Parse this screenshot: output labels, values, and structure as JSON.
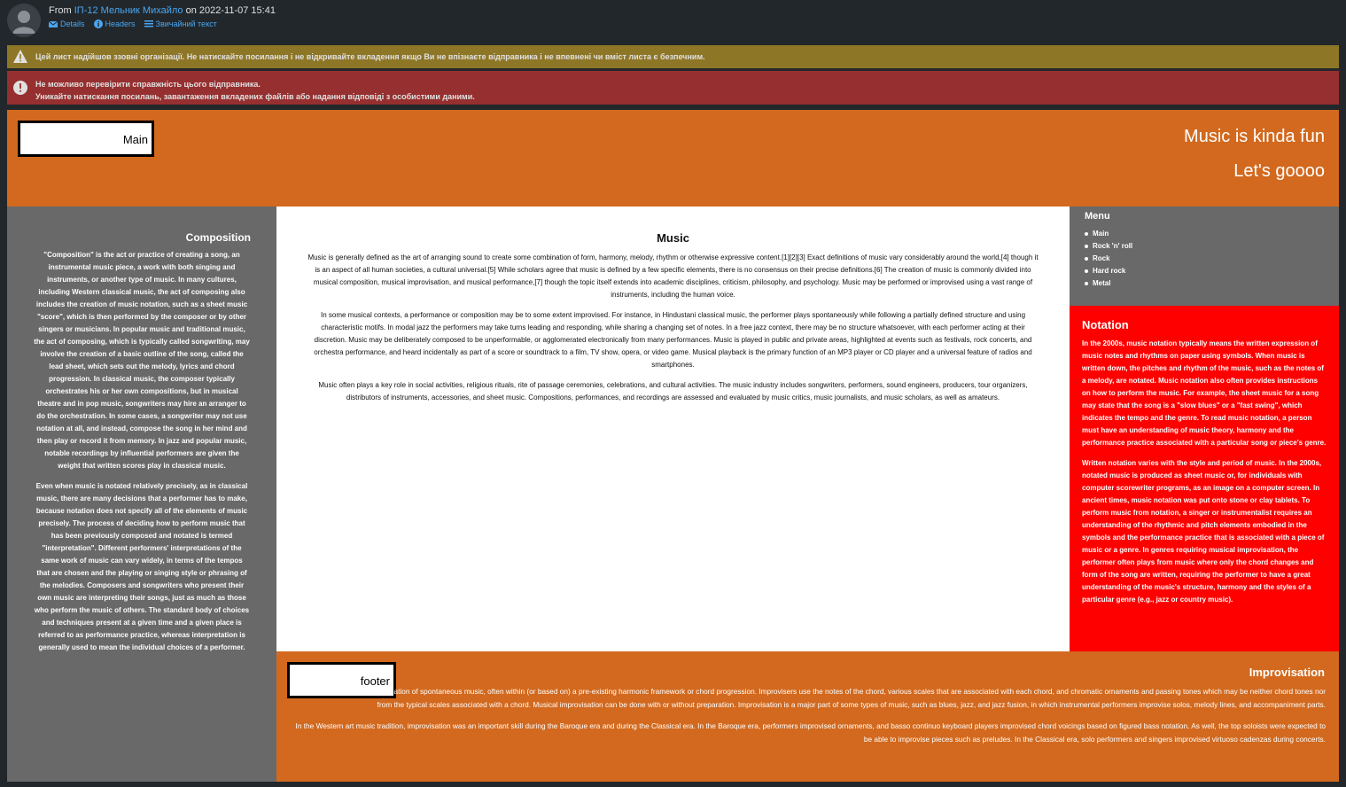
{
  "mail": {
    "from_prefix": "From",
    "sender": "ІП-12 Мельник Михайло",
    "date_prefix": "on",
    "date": "2022-11-07 15:41",
    "actions": [
      "Details",
      "Headers",
      "Звичайний текст"
    ]
  },
  "banners": {
    "warning": "Цей лист надійшов ззовні організації. Не натискайте посилання і не відкривайте вкладення якщо Ви не впізнаєте відправника і не впевнені чи вміст листа є безпечним.",
    "error_line1": "Не можливо перевірити справжність цього відправника.",
    "error_line2": "Уникайте натискання посилань, завантаження вкладених файлів або надання відповіді з особистими даними."
  },
  "header": {
    "main_button": "Main",
    "title": "Music is kinda fun",
    "subtitle": "Let's goooo"
  },
  "composition": {
    "title": "Composition",
    "p1": "\"Composition\" is the act or practice of creating a song, an instrumental music piece, a work with both singing and instruments, or another type of music. In many cultures, including Western classical music, the act of composing also includes the creation of music notation, such as a sheet music \"score\", which is then performed by the composer or by other singers or musicians. In popular music and traditional music, the act of composing, which is typically called songwriting, may involve the creation of a basic outline of the song, called the lead sheet, which sets out the melody, lyrics and chord progression. In classical music, the composer typically orchestrates his or her own compositions, but in musical theatre and in pop music, songwriters may hire an arranger to do the orchestration. In some cases, a songwriter may not use notation at all, and instead, compose the song in her mind and then play or record it from memory. In jazz and popular music, notable recordings by influential performers are given the weight that written scores play in classical music.",
    "p2": "Even when music is notated relatively precisely, as in classical music, there are many decisions that a performer has to make, because notation does not specify all of the elements of music precisely. The process of deciding how to perform music that has been previously composed and notated is termed \"interpretation\". Different performers' interpretations of the same work of music can vary widely, in terms of the tempos that are chosen and the playing or singing style or phrasing of the melodies. Composers and songwriters who present their own music are interpreting their songs, just as much as those who perform the music of others. The standard body of choices and techniques present at a given time and a given place is referred to as performance practice, whereas interpretation is generally used to mean the individual choices of a performer."
  },
  "music": {
    "title": "Music",
    "p1": "Music is generally defined as the art of arranging sound to create some combination of form, harmony, melody, rhythm or otherwise expressive content.[1][2][3] Exact definitions of music vary considerably around the world,[4] though it is an aspect of all human societies, a cultural universal.[5] While scholars agree that music is defined by a few specific elements, there is no consensus on their precise definitions.[6] The creation of music is commonly divided into musical composition, musical improvisation, and musical performance,[7] though the topic itself extends into academic disciplines, criticism, philosophy, and psychology. Music may be performed or improvised using a vast range of instruments, including the human voice.",
    "p2": "In some musical contexts, a performance or composition may be to some extent improvised. For instance, in Hindustani classical music, the performer plays spontaneously while following a partially defined structure and using characteristic motifs. In modal jazz the performers may take turns leading and responding, while sharing a changing set of notes. In a free jazz context, there may be no structure whatsoever, with each performer acting at their discretion. Music may be deliberately composed to be unperformable, or agglomerated electronically from many performances. Music is played in public and private areas, highlighted at events such as festivals, rock concerts, and orchestra performance, and heard incidentally as part of a score or soundtrack to a film, TV show, opera, or video game. Musical playback is the primary function of an MP3 player or CD player and a universal feature of radios and smartphones.",
    "p3": "Music often plays a key role in social activities, religious rituals, rite of passage ceremonies, celebrations, and cultural activities. The music industry includes songwriters, performers, sound engineers, producers, tour organizers, distributors of instruments, accessories, and sheet music. Compositions, performances, and recordings are assessed and evaluated by music critics, music journalists, and music scholars, as well as amateurs."
  },
  "menu": {
    "title": "Menu",
    "items": [
      "Main",
      "Rock 'n' roll",
      "Rock",
      "Hard rock",
      "Metal"
    ]
  },
  "notation": {
    "title": "Notation",
    "p1": "In the 2000s, music notation typically means the written expression of music notes and rhythms on paper using symbols. When music is written down, the pitches and rhythm of the music, such as the notes of a melody, are notated. Music notation also often provides instructions on how to perform the music. For example, the sheet music for a song may state that the song is a \"slow blues\" or a \"fast swing\", which indicates the tempo and the genre. To read music notation, a person must have an understanding of music theory, harmony and the performance practice associated with a particular song or piece's genre.",
    "p2": "Written notation varies with the style and period of music. In the 2000s, notated music is produced as sheet music or, for individuals with computer scorewriter programs, as an image on a computer screen. In ancient times, music notation was put onto stone or clay tablets. To perform music from notation, a singer or instrumentalist requires an understanding of the rhythmic and pitch elements embodied in the symbols and the performance practice that is associated with a piece of music or a genre. In genres requiring musical improvisation, the performer often plays from music where only the chord changes and form of the song are written, requiring the performer to have a great understanding of the music's structure, harmony and the styles of a particular genre (e.g., jazz or country music)."
  },
  "footer": {
    "button": "footer",
    "title": "Improvisation",
    "p1": "Musical improvisation is the creation of spontaneous music, often within (or based on) a pre-existing harmonic framework or chord progression. Improvisers use the notes of the chord, various scales that are associated with each chord, and chromatic ornaments and passing tones which may be neither chord tones nor from the typical scales associated with a chord. Musical improvisation can be done with or without preparation. Improvisation is a major part of some types of music, such as blues, jazz, and jazz fusion, in which instrumental performers improvise solos, melody lines, and accompaniment parts.",
    "p2": "In the Western art music tradition, improvisation was an important skill during the Baroque era and during the Classical era. In the Baroque era, performers improvised ornaments, and basso continuo keyboard players improvised chord voicings based on figured bass notation. As well, the top soloists were expected to be able to improvise pieces such as preludes. In the Classical era, solo performers and singers improvised virtuoso cadenzas during concerts."
  },
  "colors": {
    "orange": "#d2691e",
    "grey": "#696969",
    "red": "#ff0000",
    "warning": "#8e7627",
    "error": "#962f2f",
    "link": "#4aa6f0"
  },
  "icons": [
    "avatar-placeholder-icon",
    "envelope-icon",
    "info-icon",
    "list-icon",
    "warning-icon",
    "alert-icon"
  ]
}
